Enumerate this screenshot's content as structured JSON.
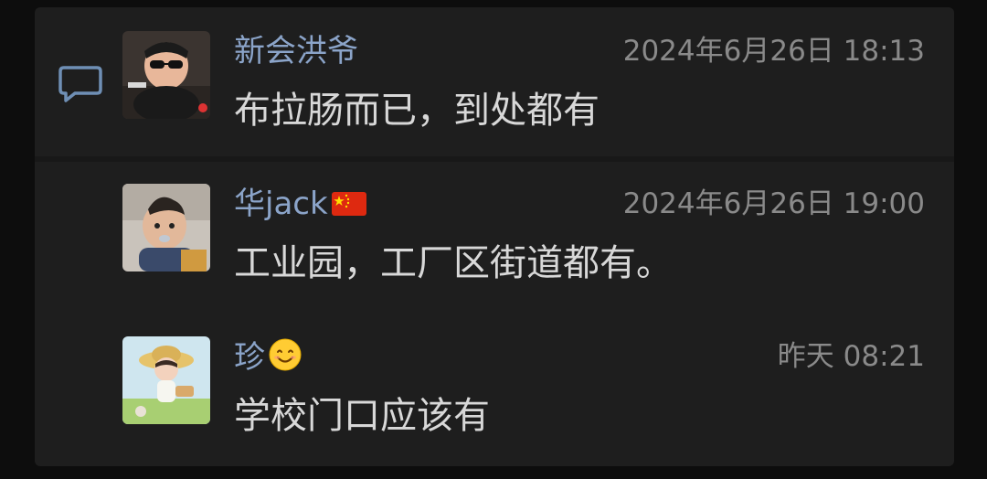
{
  "comments": [
    {
      "author": "新会洪爷",
      "time": "2024年6月26日 18:13",
      "text": "布拉肠而已，到处都有",
      "avatar": "avatar-cartoon-man-sunglasses"
    },
    {
      "author": "华jack",
      "author_badge": "china-flag-icon",
      "time": "2024年6月26日 19:00",
      "text": "工业园，工厂区街道都有。",
      "avatar": "avatar-baby-photo"
    },
    {
      "author": "珍",
      "author_badge": "smile-emoji-icon",
      "time": "昨天 08:21",
      "text": "学校门口应该有",
      "avatar": "avatar-girl-straw-hat"
    }
  ],
  "colors": {
    "background": "#0d0d0d",
    "panel": "#1e1e1e",
    "author": "#8ba4c9",
    "time": "#8a8a8a",
    "text": "#d8d8d8"
  }
}
